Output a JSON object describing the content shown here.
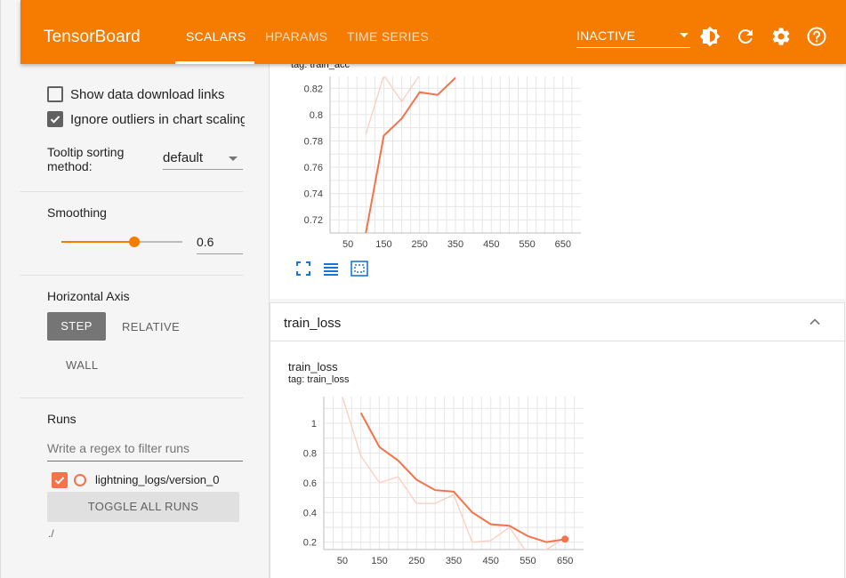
{
  "header": {
    "brand": "TensorBoard",
    "tabs": [
      "SCALARS",
      "HPARAMS",
      "TIME SERIES"
    ],
    "active_tab": "SCALARS",
    "reload_status": "INACTIVE",
    "icons": [
      "theme-toggle-icon",
      "refresh-icon",
      "settings-icon",
      "help-icon"
    ],
    "accent_color": "#f57c00"
  },
  "sidebar": {
    "show_download_links": {
      "label": "Show data download links",
      "checked": false
    },
    "ignore_outliers": {
      "label": "Ignore outliers in chart scaling",
      "checked": true
    },
    "tooltip_sorting": {
      "label_line1": "Tooltip sorting",
      "label_line2": "method:",
      "value": "default"
    },
    "smoothing": {
      "title": "Smoothing",
      "value": "0.6",
      "fraction": 0.6
    },
    "horizontal_axis": {
      "title": "Horizontal Axis",
      "options": [
        "STEP",
        "RELATIVE",
        "WALL"
      ],
      "selected": "STEP"
    },
    "runs": {
      "title": "Runs",
      "filter_placeholder": "Write a regex to filter runs",
      "items": [
        {
          "label": "lightning_logs/version_0",
          "checked": true,
          "color": "#f4734b"
        }
      ],
      "toggle_label": "TOGGLE ALL RUNS",
      "path": "./"
    }
  },
  "main": {
    "top_chart": {
      "tag_text": "tag: train_acc",
      "icons": [
        "fullscreen-icon",
        "log-scale-icon",
        "fit-domain-icon"
      ]
    },
    "section": {
      "title": "train_loss",
      "collapsed": false
    },
    "bottom_chart": {
      "title": "train_loss",
      "tag_text": "tag: train_loss"
    }
  },
  "chart_data": [
    {
      "type": "line",
      "title": "",
      "x_ticks": [
        50,
        150,
        250,
        350,
        450,
        550,
        650
      ],
      "y_ticks": [
        0.72,
        0.74,
        0.76,
        0.78,
        0.8,
        0.82
      ],
      "xlim": [
        0,
        700
      ],
      "ylim": [
        0.71,
        0.829
      ],
      "grid": true,
      "series": [
        {
          "role": "smoothed",
          "color": "#f4734b",
          "x": [
            100,
            150,
            200,
            250,
            300,
            350
          ],
          "y": [
            0.71,
            0.784,
            0.797,
            0.817,
            0.815,
            0.828
          ]
        },
        {
          "role": "raw",
          "color": "#fbd0c2",
          "x": [
            100,
            150,
            200,
            250,
            300
          ],
          "y": [
            0.785,
            0.83,
            0.81,
            0.83,
            0.83
          ]
        }
      ]
    },
    {
      "type": "line",
      "title": "train_loss",
      "x_ticks": [
        50,
        150,
        250,
        350,
        450,
        550,
        650
      ],
      "y_ticks": [
        0.2,
        0.4,
        0.6,
        0.8,
        1
      ],
      "xlim": [
        0,
        700
      ],
      "ylim": [
        0.15,
        1.18
      ],
      "grid": true,
      "series": [
        {
          "role": "smoothed",
          "color": "#f4734b",
          "x": [
            100,
            150,
            200,
            250,
            300,
            350,
            400,
            450,
            500,
            550,
            600,
            650
          ],
          "y": [
            1.07,
            0.84,
            0.75,
            0.62,
            0.55,
            0.54,
            0.4,
            0.32,
            0.31,
            0.24,
            0.2,
            0.22
          ]
        },
        {
          "role": "raw",
          "color": "#fbd0c2",
          "x": [
            50,
            100,
            150,
            200,
            250,
            300,
            350,
            400,
            450,
            500,
            550,
            600,
            650
          ],
          "y": [
            1.18,
            0.78,
            0.6,
            0.64,
            0.46,
            0.46,
            0.52,
            0.2,
            0.21,
            0.3,
            0.12,
            0.15,
            0.23
          ]
        }
      ]
    }
  ]
}
